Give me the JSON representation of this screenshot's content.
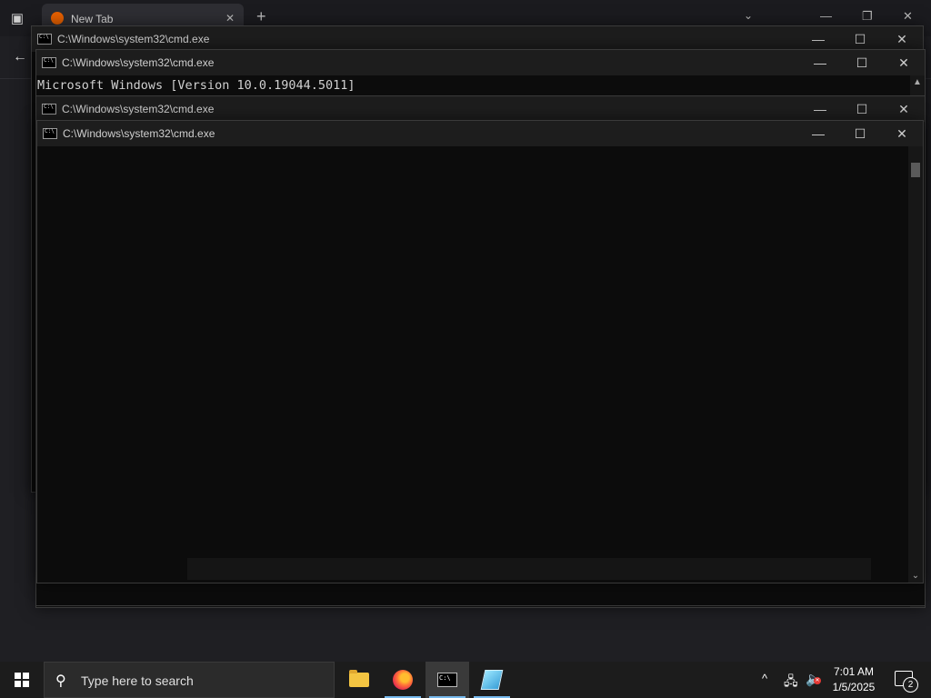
{
  "browser": {
    "tab_title": "New Tab",
    "tab_close": "✕",
    "new_tab": "+",
    "chevron": "⌄",
    "minimize": "—",
    "maximize": "❐",
    "close": "✕",
    "back": "←"
  },
  "windows": [
    {
      "title": "C:\\Windows\\system32\\cmd.exe"
    },
    {
      "title": "C:\\Windows\\system32\\cmd.exe",
      "lines": [
        "Microsoft Windows [Version 10.0.19044.5011]"
      ]
    },
    {
      "title": "C:\\Windows\\system32\\cmd.exe"
    },
    {
      "title": "C:\\Windows\\system32\\cmd.exe"
    }
  ],
  "controls": {
    "minimize": "—",
    "maximize": "☐",
    "close": "✕"
  },
  "scroll": {
    "up": "▲",
    "down": "⌄"
  },
  "taskbar": {
    "search_placeholder": "Type here to search",
    "search_icon": "⚲",
    "apps": [
      "file-explorer-icon",
      "firefox-icon",
      "command-prompt-icon",
      "notepad-icon"
    ],
    "time": "7:01 AM",
    "date": "1/5/2025",
    "tray_chevron": "^",
    "notification_count": "2"
  }
}
